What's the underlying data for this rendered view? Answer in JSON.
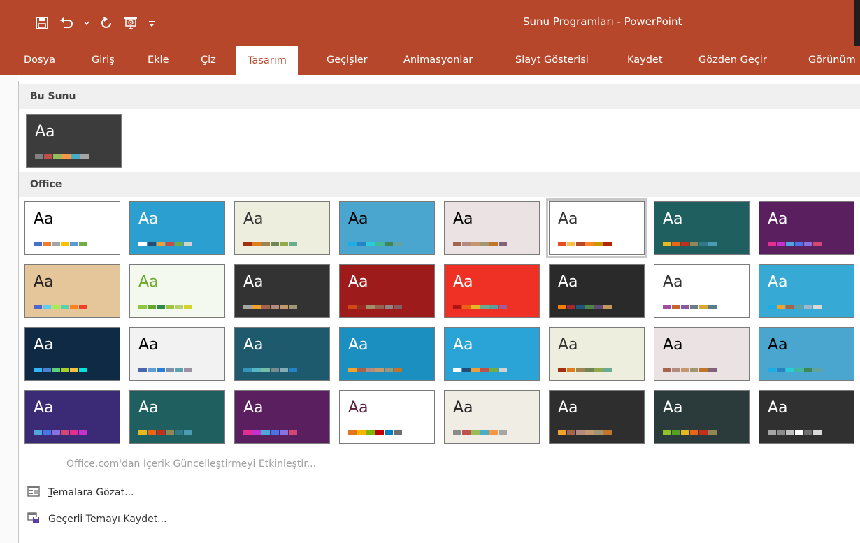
{
  "window": {
    "title": "Sunu Programları - PowerPoint"
  },
  "quick_access": {
    "icons": [
      "save-icon",
      "undo-icon",
      "undo-dropdown-icon",
      "redo-icon",
      "present-icon",
      "customize-icon"
    ]
  },
  "ribbon": {
    "tabs": [
      {
        "label": "Dosya"
      },
      {
        "label": "Giriş"
      },
      {
        "label": "Ekle"
      },
      {
        "label": "Çiz"
      },
      {
        "label": "Tasarım"
      },
      {
        "label": "Geçişler"
      },
      {
        "label": "Animasyonlar"
      },
      {
        "label": "Slayt Gösterisi"
      },
      {
        "label": "Kaydet"
      },
      {
        "label": "Gözden Geçir"
      },
      {
        "label": "Görünüm"
      }
    ],
    "active_tab": "Tasarım",
    "accent_color": "#b7472a"
  },
  "gallery": {
    "this_presentation_label": "Bu Sunu",
    "office_label": "Office",
    "theme_label": "Aa",
    "current_theme": {
      "bg": "#3c3c3c",
      "text": "#ffffff",
      "swatches": [
        "#808080",
        "#c0504d",
        "#9bbb59",
        "#f79646",
        "#4bacc6",
        "#a5a5a5"
      ]
    },
    "office_themes": [
      {
        "bg": "#ffffff",
        "text": "#000000",
        "swatches": [
          "#4472c4",
          "#ed7d31",
          "#a5a5a5",
          "#ffc000",
          "#5b9bd5",
          "#70ad47"
        ]
      },
      {
        "bg": "#2a9fd0",
        "text": "#ffffff",
        "swatches": [
          "#ffffff",
          "#1f4e79",
          "#e7a13c",
          "#c0504d",
          "#70ad47",
          "#d1d1d1"
        ]
      },
      {
        "bg": "#eeeede",
        "text": "#333333",
        "swatches": [
          "#a53010",
          "#de7e18",
          "#9f8351",
          "#728653",
          "#92aa4c",
          "#6aac91"
        ]
      },
      {
        "bg": "#4aa5cf",
        "text": "#000000",
        "swatches": [
          "#1cade4",
          "#2683c6",
          "#27ced7",
          "#42ba97",
          "#3e8853",
          "#62a39f"
        ]
      },
      {
        "bg": "#ebe3e3",
        "text": "#000000",
        "swatches": [
          "#a5644e",
          "#b58b80",
          "#c3986d",
          "#a19574",
          "#c17529",
          "#826277"
        ]
      },
      {
        "bg": "#ffffff",
        "text": "#333333",
        "swatches": [
          "#e84c22",
          "#ffbd47",
          "#b64926",
          "#ff8427",
          "#cc9900",
          "#b22600"
        ]
      },
      {
        "bg": "#1f5f5f",
        "text": "#ffffff",
        "swatches": [
          "#e6b91e",
          "#e76618",
          "#c42f1a",
          "#918655",
          "#2f7b8a",
          "#4b9bb2"
        ]
      },
      {
        "bg": "#5a1f5e",
        "text": "#ffffff",
        "swatches": [
          "#e32d91",
          "#c830cc",
          "#4ea6dc",
          "#4775e7",
          "#8971e1",
          "#d54773"
        ]
      },
      {
        "bg": "#e5c59a",
        "text": "#222222",
        "swatches": [
          "#4e67c8",
          "#5eccf3",
          "#a7ea52",
          "#5dceaf",
          "#ff8021",
          "#f14124"
        ]
      },
      {
        "bg": "#f4f9f0",
        "text": "#6ea92d",
        "swatches": [
          "#8fc73e",
          "#64a82f",
          "#2b8a46",
          "#a0c544",
          "#b6d169",
          "#d6d32a"
        ]
      },
      {
        "bg": "#333333",
        "text": "#ffffff",
        "swatches": [
          "#a5a5a5",
          "#f0a22e",
          "#a5644e",
          "#b58b80",
          "#c3986d",
          "#a19574"
        ]
      },
      {
        "bg": "#9d1b1b",
        "text": "#ffffff",
        "swatches": [
          "#d34817",
          "#9b2d1f",
          "#a28e6a",
          "#956251",
          "#918485",
          "#855d5d"
        ]
      },
      {
        "bg": "#ee3124",
        "text": "#ffffff",
        "swatches": [
          "#b01513",
          "#ea6312",
          "#e6b729",
          "#6aac90",
          "#5f9c9d",
          "#9e5e9b"
        ]
      },
      {
        "bg": "#2a2a2a",
        "text": "#ffffff",
        "swatches": [
          "#f07f09",
          "#9f2936",
          "#1b587c",
          "#4e8542",
          "#604878",
          "#c19859"
        ]
      },
      {
        "bg": "#ffffff",
        "text": "#333333",
        "swatches": [
          "#a04da3",
          "#c4652d",
          "#8b5a9e",
          "#6c7c8a",
          "#d9a92f",
          "#5b7c8d"
        ]
      },
      {
        "bg": "#36aad4",
        "text": "#ffffff",
        "swatches": [
          "#1cade4",
          "#f0a22e",
          "#a5644e",
          "#62a39f",
          "#9fb8cd",
          "#d9d9d9"
        ]
      },
      {
        "bg": "#0f2a45",
        "text": "#ffffff",
        "swatches": [
          "#31b6fd",
          "#4584d3",
          "#5bd078",
          "#a5d028",
          "#f5c040",
          "#05e0db"
        ]
      },
      {
        "bg": "#f2f2f2",
        "text": "#000000",
        "swatches": [
          "#4a66ac",
          "#629dd1",
          "#297fd5",
          "#7f8fa9",
          "#5aa2ae",
          "#9d90a0"
        ]
      },
      {
        "bg": "#1d5a6d",
        "text": "#ffffff",
        "swatches": [
          "#3494ba",
          "#58b6c0",
          "#75bda7",
          "#7a8c8e",
          "#84acb6",
          "#2683c6"
        ]
      },
      {
        "bg": "#1a8fc0",
        "text": "#ffffff",
        "swatches": [
          "#f0a22e",
          "#a5644e",
          "#b58b80",
          "#c3986d",
          "#a19574",
          "#c17529"
        ]
      },
      {
        "bg": "#2aa3d6",
        "text": "#ffffff",
        "swatches": [
          "#ffffff",
          "#1f4e79",
          "#e7a13c",
          "#c0504d",
          "#70ad47",
          "#d1d1d1"
        ]
      },
      {
        "bg": "#eeeede",
        "text": "#333333",
        "swatches": [
          "#a53010",
          "#de7e18",
          "#9f8351",
          "#728653",
          "#92aa4c",
          "#6aac91"
        ]
      },
      {
        "bg": "#ebe3e3",
        "text": "#000000",
        "swatches": [
          "#a5644e",
          "#b58b80",
          "#c3986d",
          "#a19574",
          "#c17529",
          "#826277"
        ]
      },
      {
        "bg": "#4aa5cf",
        "text": "#000000",
        "swatches": [
          "#1cade4",
          "#2683c6",
          "#27ced7",
          "#42ba97",
          "#3e8853",
          "#62a39f"
        ]
      },
      {
        "bg": "#3b2a75",
        "text": "#ffffff",
        "swatches": [
          "#4ea6dc",
          "#4775e7",
          "#8971e1",
          "#d54773",
          "#e32d91",
          "#c830cc"
        ]
      },
      {
        "bg": "#1f5f5f",
        "text": "#ffffff",
        "swatches": [
          "#e6b91e",
          "#e76618",
          "#c42f1a",
          "#918655",
          "#2f7b8a",
          "#4b9bb2"
        ]
      },
      {
        "bg": "#5a1f5e",
        "text": "#ffffff",
        "swatches": [
          "#e32d91",
          "#c830cc",
          "#4ea6dc",
          "#4775e7",
          "#8971e1",
          "#d54773"
        ]
      },
      {
        "bg": "#ffffff",
        "text": "#5a1a3a",
        "swatches": [
          "#e2751d",
          "#ffb400",
          "#7eb606",
          "#c00000",
          "#0080c0",
          "#6f6f6f"
        ]
      },
      {
        "bg": "#f0eee4",
        "text": "#222222",
        "swatches": [
          "#8b8b8b",
          "#c0504d",
          "#9bbb59",
          "#4bacc6",
          "#f79646",
          "#a5a5a5"
        ]
      },
      {
        "bg": "#2e2e2e",
        "text": "#ffffff",
        "swatches": [
          "#f0a22e",
          "#a5644e",
          "#b58b80",
          "#c3986d",
          "#a19574",
          "#c17529"
        ]
      },
      {
        "bg": "#2b3a3a",
        "text": "#ffffff",
        "swatches": [
          "#90c226",
          "#54a021",
          "#e6b91e",
          "#e76618",
          "#c42f1a",
          "#918655"
        ]
      },
      {
        "bg": "#303030",
        "text": "#ffffff",
        "swatches": [
          "#a5a5a5",
          "#8b8b8b",
          "#c0c0c0",
          "#ffffff",
          "#6f6f6f",
          "#d9d9d9"
        ]
      }
    ]
  },
  "menu": {
    "enable_updates": "Office.com'dan İçerik Güncelleştirmeyi Etkinleştir...",
    "browse_themes_first": "T",
    "browse_themes_rest": "emalara Gözat...",
    "save_theme_first": "G",
    "save_theme_rest": "eçerli Temayı Kaydet..."
  }
}
